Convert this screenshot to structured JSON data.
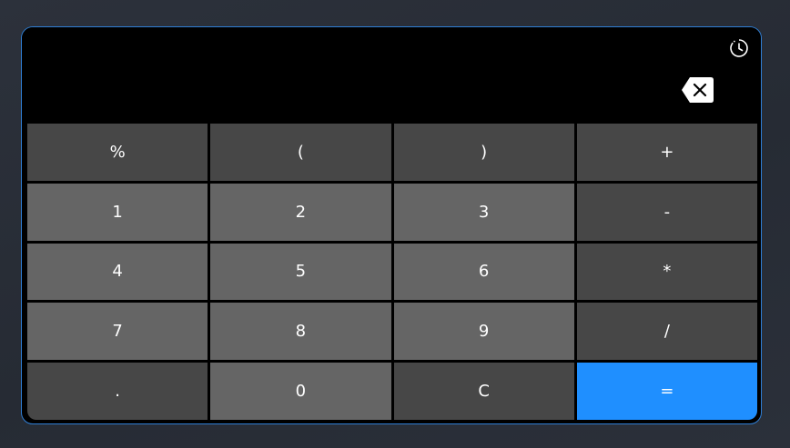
{
  "display": {
    "value": "",
    "history_icon": "clock-history-icon",
    "backspace_icon": "backspace-icon"
  },
  "keys": [
    {
      "label": "%",
      "name": "key-percent",
      "tone": "dark"
    },
    {
      "label": "(",
      "name": "key-open-paren",
      "tone": "dark"
    },
    {
      "label": ")",
      "name": "key-close-paren",
      "tone": "dark"
    },
    {
      "label": "+",
      "name": "key-plus",
      "tone": "dark"
    },
    {
      "label": "1",
      "name": "key-1",
      "tone": "light"
    },
    {
      "label": "2",
      "name": "key-2",
      "tone": "light"
    },
    {
      "label": "3",
      "name": "key-3",
      "tone": "light"
    },
    {
      "label": "-",
      "name": "key-minus",
      "tone": "dark"
    },
    {
      "label": "4",
      "name": "key-4",
      "tone": "light"
    },
    {
      "label": "5",
      "name": "key-5",
      "tone": "light"
    },
    {
      "label": "6",
      "name": "key-6",
      "tone": "light"
    },
    {
      "label": "*",
      "name": "key-multiply",
      "tone": "dark"
    },
    {
      "label": "7",
      "name": "key-7",
      "tone": "light"
    },
    {
      "label": "8",
      "name": "key-8",
      "tone": "light"
    },
    {
      "label": "9",
      "name": "key-9",
      "tone": "light"
    },
    {
      "label": "/",
      "name": "key-divide",
      "tone": "dark"
    },
    {
      "label": ".",
      "name": "key-decimal",
      "tone": "dark"
    },
    {
      "label": "0",
      "name": "key-0",
      "tone": "light"
    },
    {
      "label": "C",
      "name": "key-clear",
      "tone": "dark"
    },
    {
      "label": "=",
      "name": "key-equals",
      "tone": "accent"
    }
  ],
  "colors": {
    "accent": "#1f8fff",
    "key_dark": "#474747",
    "key_light": "#656565",
    "frame_border": "#2f7fd6",
    "display_bg": "#000000"
  }
}
